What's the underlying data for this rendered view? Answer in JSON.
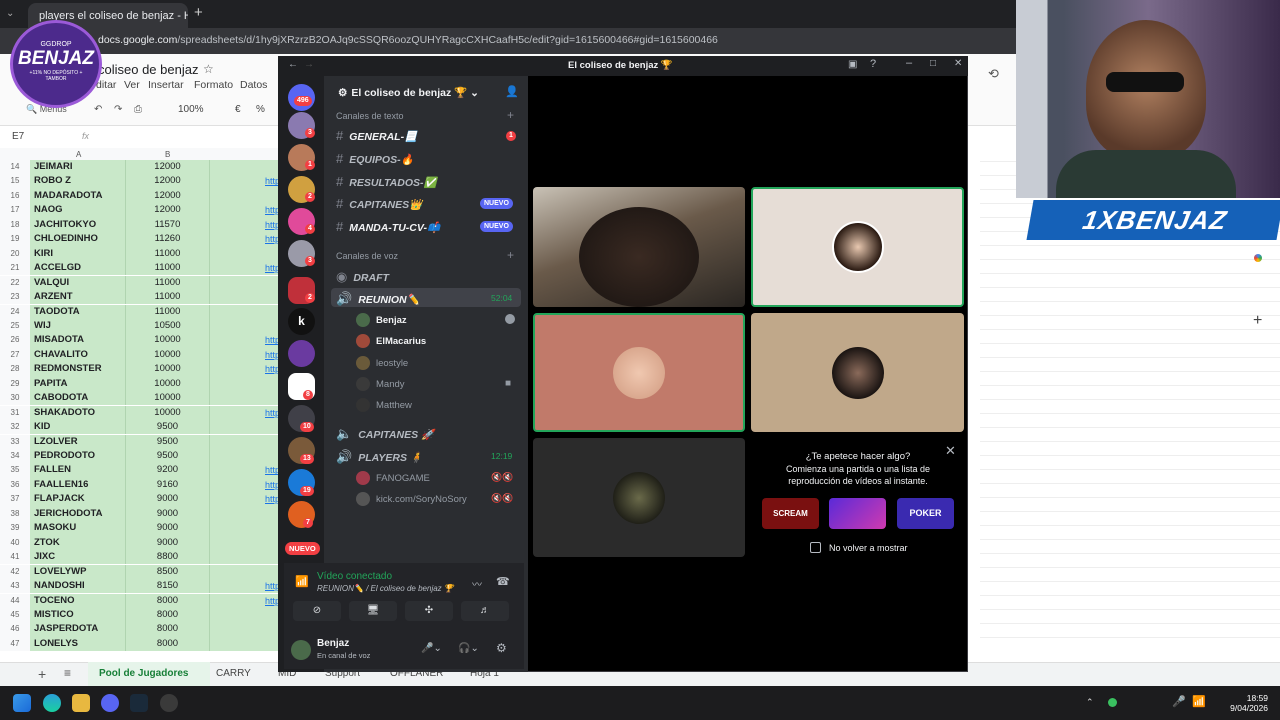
{
  "chrome": {
    "tab_title": "players el coliseo de benjaz - Hoja",
    "url_host": "docs.google.com",
    "url_path": "/spreadsheets/d/1hy9jXRzrzB2OAJq9cSSQR6oozQUHYRagcCXHCaafH5c/edit?gid=1615600466#gid=1615600466"
  },
  "overlay_logo": {
    "top": "GGDROP",
    "name": "BENJAZ",
    "sub": "+11% NO DEPÓSITO + TAMBOR"
  },
  "sheets": {
    "title": "coliseo de benjaz",
    "menu": [
      "ditar",
      "Ver",
      "Insertar",
      "Formato",
      "Datos"
    ],
    "search": "Menús",
    "zoom": "100%",
    "currency": "€",
    "percent": "%",
    "namebox": "E7",
    "fx": "fx",
    "col_a": "A",
    "col_b": "B",
    "link_text": "http",
    "rows": [
      {
        "n": "14",
        "name": "JEIMARI",
        "value": "12000"
      },
      {
        "n": "15",
        "name": "ROBO Z",
        "value": "12000"
      },
      {
        "n": "16",
        "name": "MADARADOTA",
        "value": "12000"
      },
      {
        "n": "17",
        "name": "NAOG",
        "value": "12000"
      },
      {
        "n": "18",
        "name": "JACHITOKYO",
        "value": "11570"
      },
      {
        "n": "19",
        "name": "CHLOEDINHO",
        "value": "11260"
      },
      {
        "n": "20",
        "name": "KIRI",
        "value": "11000"
      },
      {
        "n": "21",
        "name": "ACCELGD",
        "value": "11000"
      },
      {
        "n": "22",
        "name": "VALQUI",
        "value": "11000"
      },
      {
        "n": "23",
        "name": "ARZENT",
        "value": "11000"
      },
      {
        "n": "24",
        "name": "TAODOTA",
        "value": "11000"
      },
      {
        "n": "25",
        "name": "WIJ",
        "value": "10500"
      },
      {
        "n": "26",
        "name": "MISADOTA",
        "value": "10000"
      },
      {
        "n": "27",
        "name": "CHAVALITO",
        "value": "10000"
      },
      {
        "n": "28",
        "name": "REDMONSTER",
        "value": "10000"
      },
      {
        "n": "29",
        "name": "PAPITA",
        "value": "10000"
      },
      {
        "n": "30",
        "name": "CABODOTA",
        "value": "10000"
      },
      {
        "n": "31",
        "name": "SHAKADOTO",
        "value": "10000"
      },
      {
        "n": "32",
        "name": "KID",
        "value": "9500"
      },
      {
        "n": "33",
        "name": "LZOLVER",
        "value": "9500"
      },
      {
        "n": "34",
        "name": "PEDRODOTO",
        "value": "9500"
      },
      {
        "n": "35",
        "name": "FALLEN",
        "value": "9200"
      },
      {
        "n": "36",
        "name": "FAALLEN16",
        "value": "9160"
      },
      {
        "n": "37",
        "name": "FLAPJACK",
        "value": "9000"
      },
      {
        "n": "38",
        "name": "JERICHODOTA",
        "value": "9000"
      },
      {
        "n": "39",
        "name": "MASOKU",
        "value": "9000"
      },
      {
        "n": "40",
        "name": "ZTOK",
        "value": "9000"
      },
      {
        "n": "41",
        "name": "JIXC",
        "value": "8800"
      },
      {
        "n": "42",
        "name": "LOVELYWP",
        "value": "8500"
      },
      {
        "n": "43",
        "name": "NANDOSHI",
        "value": "8150"
      },
      {
        "n": "44",
        "name": "TOCENO",
        "value": "8000"
      },
      {
        "n": "45",
        "name": "MISTICO",
        "value": "8000"
      },
      {
        "n": "46",
        "name": "JASPERDOTA",
        "value": "8000"
      },
      {
        "n": "47",
        "name": "LONELYS",
        "value": "8000"
      }
    ],
    "tabs": [
      "Pool de Jugadores",
      "CARRY",
      "MID",
      "Support",
      "OFFLANER",
      "Hoja 1"
    ]
  },
  "discord": {
    "window_title": "El coliseo de benjaz 🏆",
    "server_name": "El coliseo de benjaz 🏆",
    "text_category": "Canales de texto",
    "voice_category": "Canales de voz",
    "text_channels": [
      {
        "name": "GENERAL-📃",
        "badge": "1"
      },
      {
        "name": "EQUIPOS-🔥",
        "badge": ""
      },
      {
        "name": "RESULTADOS-✅",
        "badge": ""
      },
      {
        "name": "CAPITANES👑",
        "badge": "NUEVO"
      },
      {
        "name": "MANDA-TU-CV-📫",
        "badge": "NUEVO"
      }
    ],
    "voice_draft": "DRAFT",
    "voice_reunion": "REUNION✏️",
    "reunion_time": "52:04",
    "reunion_users": [
      "Benjaz",
      "ElMacarius",
      "leostyle",
      "Mandy",
      "Matthew"
    ],
    "voice_capitanes": "CAPITANES 🚀",
    "voice_players": "PLAYERS 🧍",
    "players_time": "12:19",
    "players_users": [
      "FANOGAME",
      "kick.com/SoryNoSory"
    ],
    "server_badges": [
      "496",
      "3",
      "1",
      "2",
      "4",
      "3",
      "2",
      "8",
      "10",
      "13",
      "19",
      "7"
    ],
    "server_k": "k",
    "nuevo_label": "NUEVO",
    "voice_status": "Vídeo conectado",
    "voice_location": "REUNION✏️ / El coliseo de benjaz 🏆",
    "user_name": "Benjaz",
    "user_status": "En canal de voz",
    "activity": {
      "title": "¿Te apetece hacer algo?",
      "body": "Comienza una partida o una lista de reproducción de vídeos al instante.",
      "games": [
        "SCREAM",
        "",
        "POKER"
      ],
      "checkbox": "No volver a mostrar"
    }
  },
  "webcam_banner": "1XBENJAZ",
  "taskbar": {
    "time": "18:59",
    "date": "9/04/2026"
  }
}
